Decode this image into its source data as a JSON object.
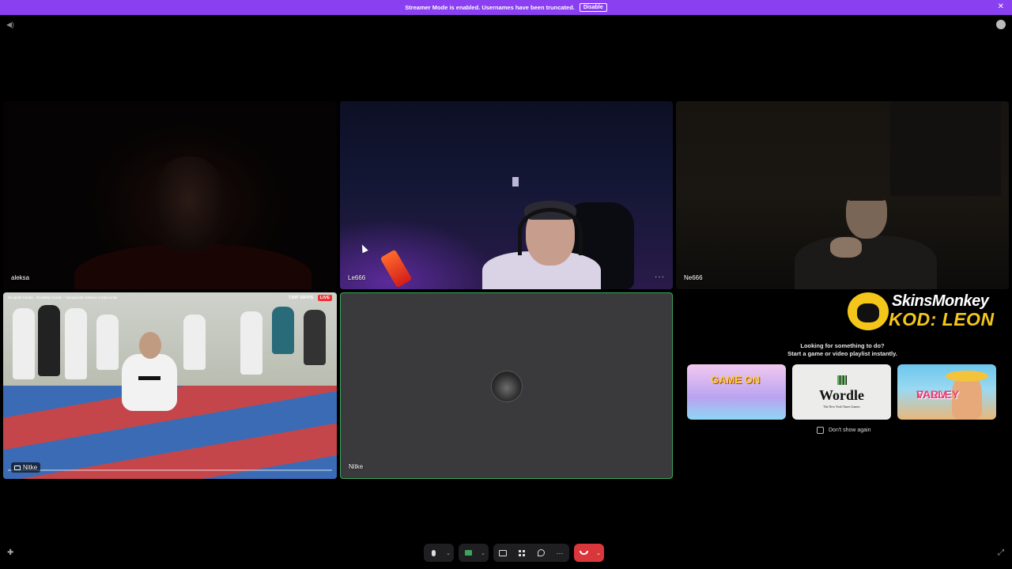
{
  "banner": {
    "message": "Streamer Mode is enabled. Usernames have been truncated.",
    "disable_label": "Disable",
    "bg_color": "#8a3ff0"
  },
  "tiles": {
    "aleksa": {
      "name": "aleksa"
    },
    "le": {
      "name": "Le666"
    },
    "ne": {
      "name": "Ne666"
    },
    "stream": {
      "name": "Nitke",
      "video_title": "Nicopole Karate - Disability Karate - Campionato Italiano a Kata Unipi",
      "resolution": "720P 30FPS",
      "live_label": "LIVE"
    },
    "nitke": {
      "name": "Nitke",
      "speaking_color": "#3ba55c"
    }
  },
  "activity": {
    "ad_brand": "SkinsMonkey",
    "ad_code": "KOD: LEON",
    "heading_line1": "Looking for something to do?",
    "heading_line2": "Start a game or video playlist instantly.",
    "cards": [
      {
        "title": "GAME ON"
      },
      {
        "title": "Wordle",
        "subtitle": "The New York Times Games"
      },
      {
        "title": "FARM",
        "title_line2": "VALLEY"
      }
    ],
    "dont_show_label": "Don't show again",
    "dont_show_checked": false
  },
  "controls": {
    "icons": [
      "microphone-icon",
      "camera-icon",
      "screen-share-icon",
      "activities-icon",
      "soundboard-icon",
      "more-icon",
      "end-call-icon"
    ],
    "end_call_color": "#da373c"
  }
}
